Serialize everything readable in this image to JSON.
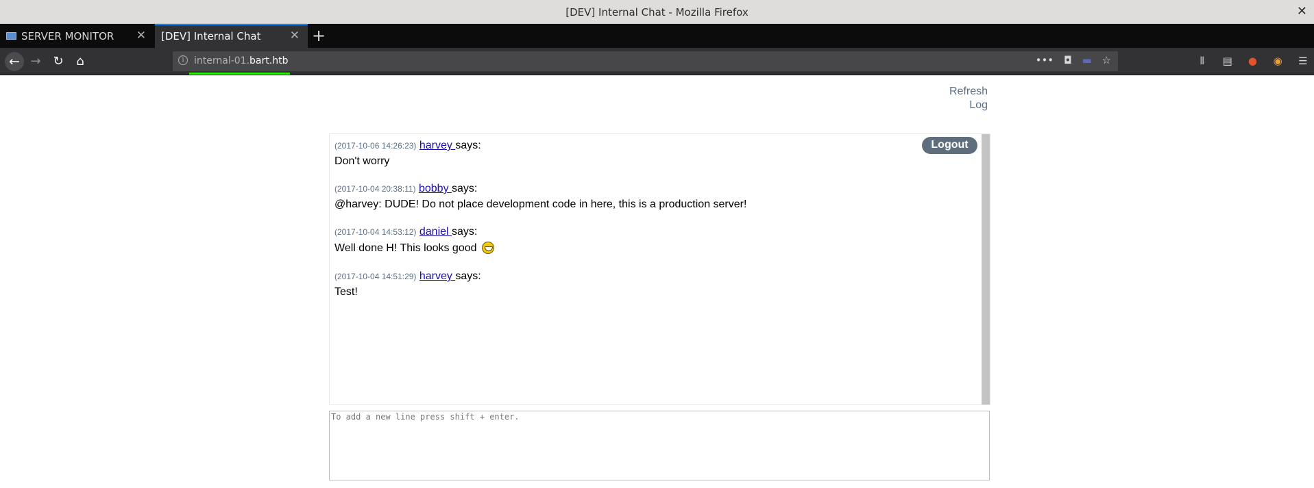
{
  "window": {
    "title": "[DEV] Internal Chat - Mozilla Firefox",
    "close_glyph": "✕"
  },
  "tabs": [
    {
      "label": "SERVER MONITOR",
      "icon": "page-favicon-icon",
      "active": false
    },
    {
      "label": "[DEV] Internal Chat",
      "icon": "",
      "active": true
    }
  ],
  "navbar": {
    "url_subdomain": "internal-01.",
    "url_domain": "bart.htb"
  },
  "page": {
    "refresh_label": "Refresh",
    "log_label": "Log",
    "logout_label": "Logout",
    "messages": [
      {
        "timestamp": "(2017-10-06 14:26:23)",
        "user": "harvey ",
        "says": "says:",
        "text": "Don't worry",
        "emoji": ""
      },
      {
        "timestamp": "(2017-10-04 20:38:11)",
        "user": "bobby ",
        "says": "says:",
        "text": "@harvey: DUDE! Do not place development code in here, this is a production server!",
        "emoji": ""
      },
      {
        "timestamp": "(2017-10-04 14:53:12)",
        "user": "daniel ",
        "says": "says:",
        "text": "Well done H! This looks good",
        "emoji": "grinning-smiley-icon"
      },
      {
        "timestamp": "(2017-10-04 14:51:29)",
        "user": "harvey ",
        "says": "says:",
        "text": "Test!",
        "emoji": ""
      }
    ],
    "input_placeholder": "To add a new line press shift + enter."
  },
  "colors": {
    "tab_accent": "#0a84ff",
    "load_progress": "#30e60b",
    "logout_bg": "#5f6e7d",
    "link_blue": "#1a0dab"
  }
}
